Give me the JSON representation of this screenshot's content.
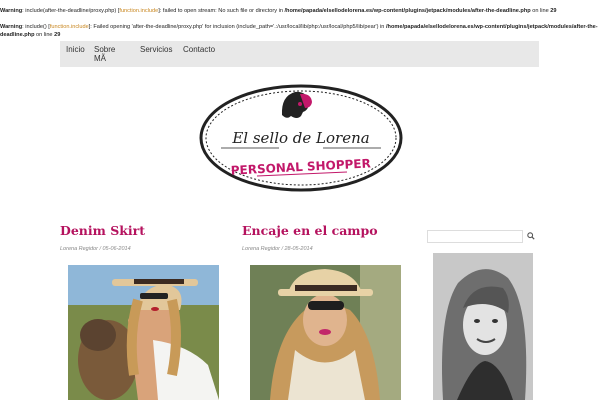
{
  "warnings": {
    "w1": {
      "label": "Warning",
      "text1": ": include(after-the-deadline/proxy.php) [",
      "link": "function.include",
      "text2": "]: failed to open stream: No such file or directory in ",
      "path": "/home/papada/elsellodelorena.es/wp-content/plugins/jetpack/modules/after-the-deadline.php",
      "text3": " on line ",
      "line": "29"
    },
    "w2": {
      "label": "Warning",
      "text1": ": include() [",
      "link": "function.include",
      "text2": "]: Failed opening 'after-the-deadline/proxy.php' for inclusion (include_path='.:/usr/local/lib/php:/usr/local/php5/lib/pear') in ",
      "path": "/home/papada/elsellodelorena.es/wp-content/plugins/jetpack/modules/after-the-deadline.php",
      "text3": " on line ",
      "line": "29"
    }
  },
  "nav": {
    "items": [
      "Inicio",
      "Sobre MÃ",
      "Servicios",
      "Contacto"
    ]
  },
  "logo": {
    "script": "El sello de Lorena",
    "tagline": "PERSONAL SHOPPER"
  },
  "posts": [
    {
      "title": "Denim Skirt",
      "meta": "Lorena Regidor / 05-06-2014"
    },
    {
      "title": "Encaje en el campo",
      "meta": "Lorena Regidor / 28-05-2014"
    }
  ],
  "colors": {
    "accent": "#b5125e",
    "nav_bg": "#e8e8e8",
    "link": "#c8861e"
  }
}
